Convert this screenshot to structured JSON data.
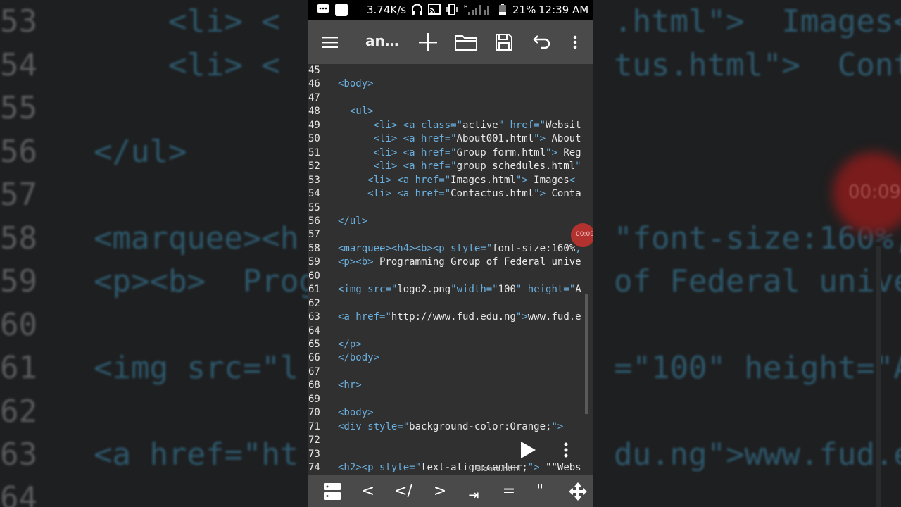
{
  "background": {
    "lines": [
      {
        "n": "53",
        "code": "    <li> <",
        "right": ".html\">  Images<"
      },
      {
        "n": "54",
        "code": "    <li> <",
        "right": "tus.html\">  Conta"
      },
      {
        "n": "55",
        "code": "",
        "right": ""
      },
      {
        "n": "56",
        "code": "</ul>",
        "right": ""
      },
      {
        "n": "57",
        "code": "",
        "right": ""
      },
      {
        "n": "58",
        "code": "<marquee><h",
        "right": "\"font-size:160%,"
      },
      {
        "n": "59",
        "code": "<p><b>  Prog",
        "right": "of Federal unive"
      },
      {
        "n": "60",
        "code": "",
        "right": ""
      },
      {
        "n": "61",
        "code": "<img src=\"l",
        "right": "=\"100\" height=\"A"
      },
      {
        "n": "62",
        "code": "",
        "right": ""
      },
      {
        "n": "63",
        "code": "<a href=\"ht",
        "right": "du.ng\">www.fud.e"
      },
      {
        "n": "64",
        "code": "",
        "right": ""
      }
    ],
    "timer": "00:09"
  },
  "statusbar": {
    "speed": "3.74K/s",
    "battery": "21%",
    "time": "12:39 AM",
    "signal_label": "H"
  },
  "toolbar": {
    "title": "an…",
    "icons": [
      "menu-icon",
      "plus-icon",
      "folder-icon",
      "save-icon",
      "undo-icon",
      "more-vert-icon"
    ]
  },
  "editor": {
    "lines": [
      {
        "n": "45",
        "segs": []
      },
      {
        "n": "46",
        "segs": [
          {
            "c": "t",
            "v": "<body>"
          }
        ]
      },
      {
        "n": "47",
        "segs": []
      },
      {
        "n": "48",
        "segs": [
          {
            "c": "s",
            "v": "  "
          },
          {
            "c": "t",
            "v": "<ul>"
          }
        ]
      },
      {
        "n": "49",
        "segs": [
          {
            "c": "s",
            "v": "      "
          },
          {
            "c": "t",
            "v": "<li> <a "
          },
          {
            "c": "a",
            "v": "class="
          },
          {
            "c": "a",
            "v": "\""
          },
          {
            "c": "s",
            "v": "active"
          },
          {
            "c": "a",
            "v": "\" href=\""
          },
          {
            "c": "s",
            "v": "Websit"
          }
        ]
      },
      {
        "n": "50",
        "segs": [
          {
            "c": "s",
            "v": "      "
          },
          {
            "c": "t",
            "v": "<li> <a "
          },
          {
            "c": "a",
            "v": "href=\""
          },
          {
            "c": "s",
            "v": "About001.html"
          },
          {
            "c": "a",
            "v": "\">"
          },
          {
            "c": "s",
            "v": " About"
          }
        ]
      },
      {
        "n": "51",
        "segs": [
          {
            "c": "s",
            "v": "      "
          },
          {
            "c": "t",
            "v": "<li> <a "
          },
          {
            "c": "a",
            "v": "href=\""
          },
          {
            "c": "s",
            "v": "Group form.html"
          },
          {
            "c": "a",
            "v": "\">"
          },
          {
            "c": "s",
            "v": " Reg"
          }
        ]
      },
      {
        "n": "52",
        "segs": [
          {
            "c": "s",
            "v": "      "
          },
          {
            "c": "t",
            "v": "<li> <a "
          },
          {
            "c": "a",
            "v": "href=\""
          },
          {
            "c": "s",
            "v": "group schedules.html"
          },
          {
            "c": "a",
            "v": "\""
          }
        ]
      },
      {
        "n": "53",
        "segs": [
          {
            "c": "s",
            "v": "     "
          },
          {
            "c": "t",
            "v": "<li> <a "
          },
          {
            "c": "a",
            "v": "href=\""
          },
          {
            "c": "s",
            "v": "Images.html"
          },
          {
            "c": "a",
            "v": "\">"
          },
          {
            "c": "s",
            "v": " Images"
          },
          {
            "c": "t",
            "v": "<"
          }
        ]
      },
      {
        "n": "54",
        "segs": [
          {
            "c": "s",
            "v": "     "
          },
          {
            "c": "t",
            "v": "<li> <a "
          },
          {
            "c": "a",
            "v": "href=\""
          },
          {
            "c": "s",
            "v": "Contactus.html"
          },
          {
            "c": "a",
            "v": "\">"
          },
          {
            "c": "s",
            "v": " Conta"
          }
        ]
      },
      {
        "n": "55",
        "segs": []
      },
      {
        "n": "56",
        "segs": [
          {
            "c": "t",
            "v": "</ul>"
          }
        ]
      },
      {
        "n": "57",
        "segs": []
      },
      {
        "n": "58",
        "segs": [
          {
            "c": "t",
            "v": "<marquee><h4><b><p "
          },
          {
            "c": "a",
            "v": "style=\""
          },
          {
            "c": "s",
            "v": "font-size:160%"
          },
          {
            "c": "a",
            "v": ","
          }
        ]
      },
      {
        "n": "59",
        "segs": [
          {
            "c": "t",
            "v": "<p><b>"
          },
          {
            "c": "s",
            "v": " Programming Group of Federal unive"
          }
        ]
      },
      {
        "n": "60",
        "segs": []
      },
      {
        "n": "61",
        "segs": [
          {
            "c": "t",
            "v": "<img "
          },
          {
            "c": "a",
            "v": "src=\""
          },
          {
            "c": "s",
            "v": "logo2.png"
          },
          {
            "c": "a",
            "v": "\"width=\""
          },
          {
            "c": "s",
            "v": "100"
          },
          {
            "c": "a",
            "v": "\" height=\""
          },
          {
            "c": "s",
            "v": "A"
          }
        ]
      },
      {
        "n": "62",
        "segs": []
      },
      {
        "n": "63",
        "segs": [
          {
            "c": "t",
            "v": "<a "
          },
          {
            "c": "a",
            "v": "href=\""
          },
          {
            "c": "s",
            "v": "http://www.fud.edu.ng"
          },
          {
            "c": "a",
            "v": "\">"
          },
          {
            "c": "s",
            "v": "www.fud.e"
          }
        ]
      },
      {
        "n": "64",
        "segs": []
      },
      {
        "n": "65",
        "segs": [
          {
            "c": "t",
            "v": "</p>"
          }
        ]
      },
      {
        "n": "66",
        "segs": [
          {
            "c": "t",
            "v": "</body>"
          }
        ]
      },
      {
        "n": "67",
        "segs": []
      },
      {
        "n": "68",
        "segs": [
          {
            "c": "t",
            "v": "<hr>"
          }
        ]
      },
      {
        "n": "69",
        "segs": []
      },
      {
        "n": "70",
        "segs": [
          {
            "c": "t",
            "v": "<body>"
          }
        ]
      },
      {
        "n": "71",
        "segs": [
          {
            "c": "t",
            "v": "<div "
          },
          {
            "c": "a",
            "v": "style=\""
          },
          {
            "c": "s",
            "v": "background-color:Orange;"
          },
          {
            "c": "a",
            "v": "\">"
          }
        ]
      },
      {
        "n": "72",
        "segs": []
      },
      {
        "n": "73",
        "segs": []
      },
      {
        "n": "74",
        "segs": [
          {
            "c": "t",
            "v": "<h2><p "
          },
          {
            "c": "a",
            "v": "style=\""
          },
          {
            "c": "s",
            "v": "text-align:center;"
          },
          {
            "c": "a",
            "v": "\">"
          },
          {
            "c": "s",
            "v": " \"\"Webs"
          }
        ]
      }
    ],
    "timer": "00:09",
    "caption": "Blome.html"
  },
  "bottombar": {
    "keys": [
      {
        "name": "snippets-icon",
        "label": ""
      },
      {
        "name": "key-lt",
        "label": "<"
      },
      {
        "name": "key-close-tag",
        "label": "</"
      },
      {
        "name": "key-gt",
        "label": ">"
      },
      {
        "name": "key-tab",
        "label": "⇥"
      },
      {
        "name": "key-equals",
        "label": "="
      },
      {
        "name": "key-quote",
        "label": "\""
      },
      {
        "name": "move-cursor-icon",
        "label": ""
      }
    ]
  },
  "colors": {
    "tag": "#6ab0e0",
    "text": "#e8e8e8",
    "editor_bg": "#303030",
    "toolbar_bg": "#4a4a4a"
  }
}
